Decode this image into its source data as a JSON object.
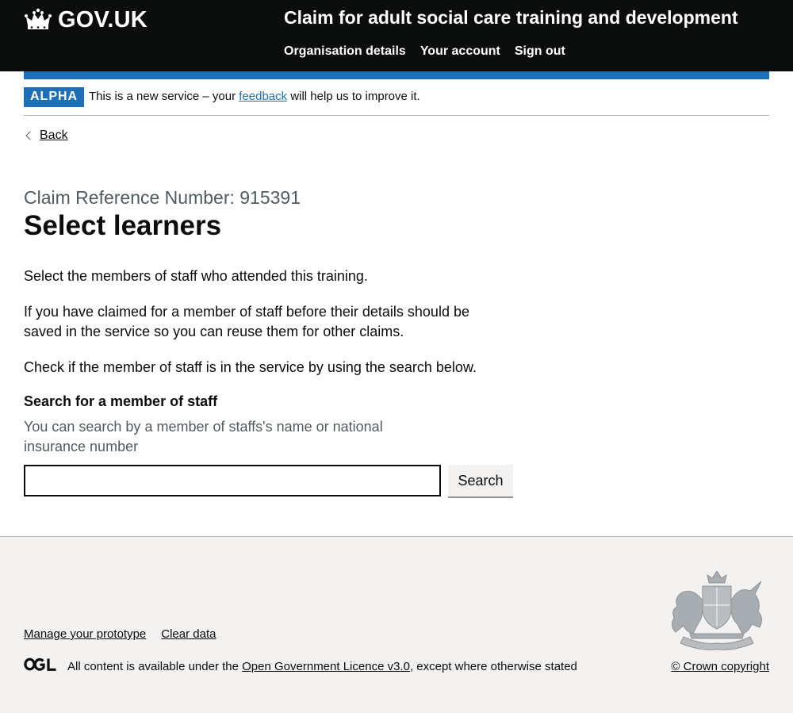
{
  "header": {
    "logo_text": "GOV.UK",
    "service_name": "Claim for adult social care training and development",
    "nav": [
      {
        "label": "Organisation details"
      },
      {
        "label": "Your account"
      },
      {
        "label": "Sign out"
      }
    ]
  },
  "phase_banner": {
    "tag": "ALPHA",
    "text_before": "This is a new service – your ",
    "link": "feedback",
    "text_after": " will help us to improve it."
  },
  "back_link": "Back",
  "page": {
    "caption": "Claim Reference Number: 915391",
    "title": "Select learners",
    "paragraphs": [
      "Select the members of staff who attended this training.",
      "If you have claimed for a member of staff before their details should be saved in the service so you can reuse them for other claims.",
      "Check if the member of staff is in the service by using the search below."
    ]
  },
  "search": {
    "label": "Search for a member of staff",
    "hint": "You can search by a member of staffs's name or national insurance number",
    "value": "",
    "button": "Search"
  },
  "footer": {
    "links": [
      "Manage your prototype",
      "Clear data"
    ],
    "licence_before": "All content is available under the ",
    "licence_link": "Open Government Licence v3.0",
    "licence_after": ", except where otherwise stated",
    "copyright": "© Crown copyright"
  },
  "colors": {
    "header_bg": "#0b0c0c",
    "brand_blue": "#1d70b8",
    "footer_bg": "#f3f2f1",
    "secondary_text": "#505a5f"
  }
}
